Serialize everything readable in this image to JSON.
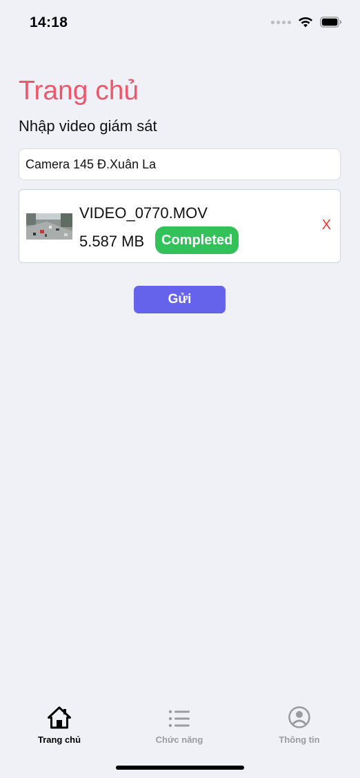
{
  "status_bar": {
    "time": "14:18"
  },
  "header": {
    "title": "Trang chủ",
    "subtitle": "Nhập video giám sát"
  },
  "camera_input": {
    "value": "Camera 145 Đ.Xuân La"
  },
  "file": {
    "name": "VIDEO_0770.MOV",
    "size": "5.587 MB",
    "status": "Completed",
    "remove_label": "X"
  },
  "send_button": {
    "label": "Gửi"
  },
  "tabs": [
    {
      "label": "Trang chủ",
      "icon": "home-icon",
      "active": true
    },
    {
      "label": "Chức năng",
      "icon": "list-icon",
      "active": false
    },
    {
      "label": "Thông tin",
      "icon": "user-circle-icon",
      "active": false
    }
  ],
  "colors": {
    "title": "#f0566b",
    "accent_button": "#6563ec",
    "status_completed": "#33c15a",
    "remove": "#f0362f",
    "background": "#eff1f6"
  }
}
